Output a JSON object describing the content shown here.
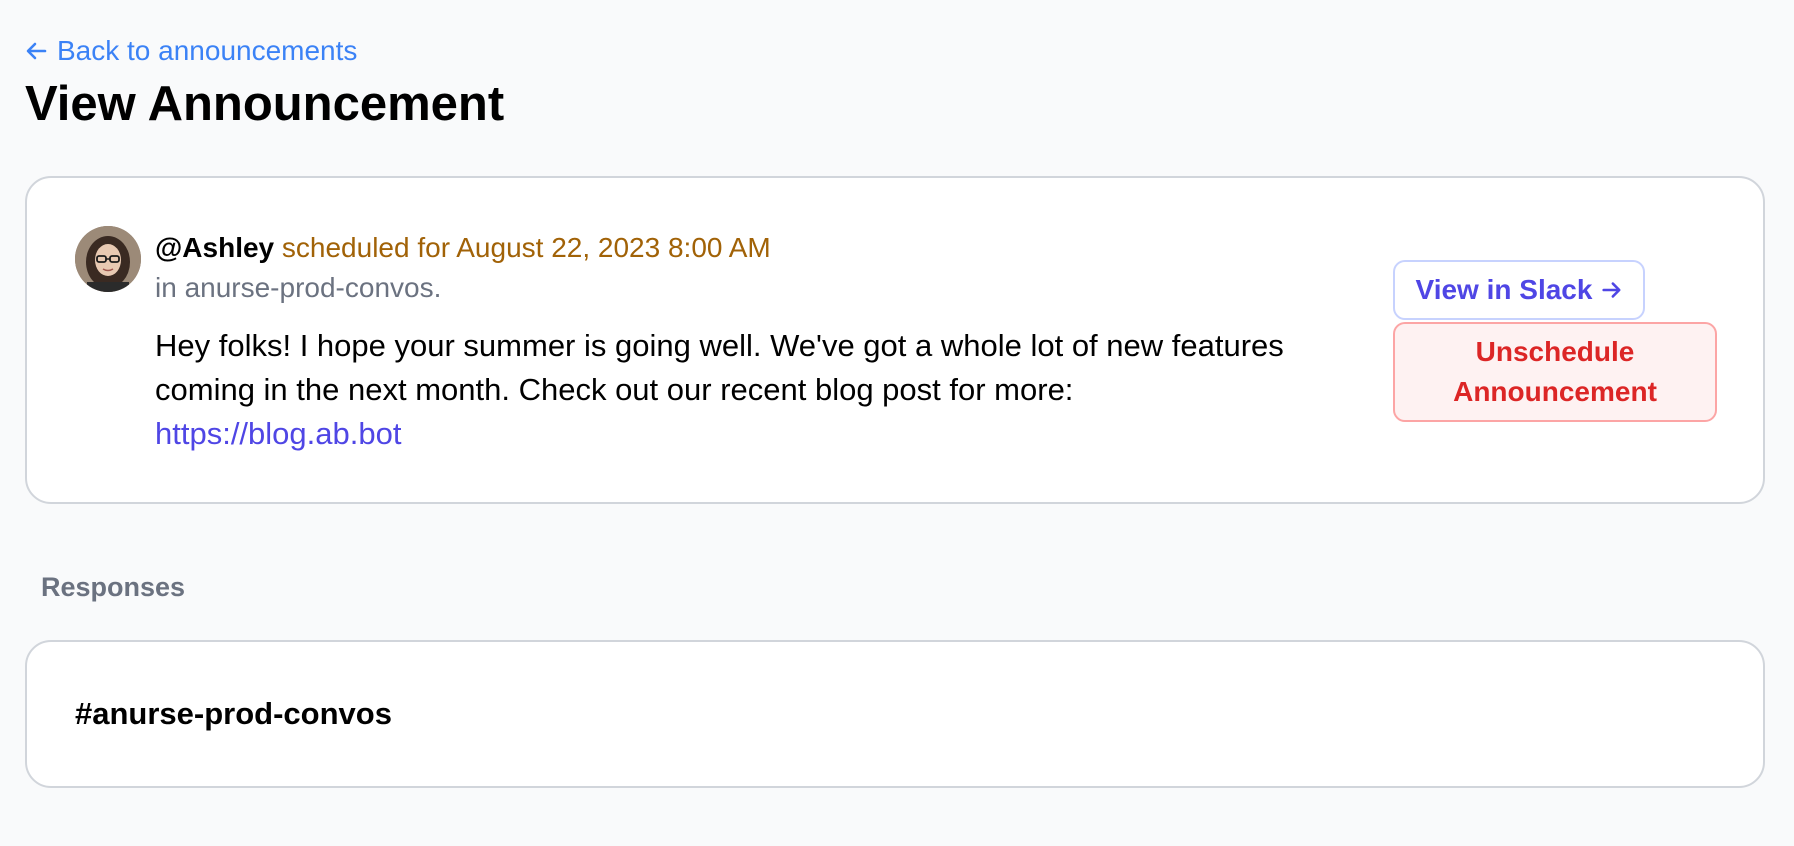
{
  "navigation": {
    "back_label": "Back to announcements"
  },
  "page": {
    "title": "View Announcement"
  },
  "announcement": {
    "author": "@Ashley",
    "schedule_text": "scheduled for August 22, 2023 8:00 AM",
    "channel_text": "in anurse-prod-convos.",
    "message": "Hey folks! I hope your summer is going well. We've got a whole lot of new features coming in the next month. Check out our recent blog post for more:",
    "link": "https://blog.ab.bot",
    "avatar_icon": "user-avatar"
  },
  "actions": {
    "view_in_slack": "View in Slack",
    "unschedule": "Unschedule Announcement"
  },
  "responses": {
    "label": "Responses",
    "channels": [
      {
        "name": "#anurse-prod-convos"
      }
    ]
  },
  "colors": {
    "link_blue": "#3b82f6",
    "accent_indigo": "#4f46e5",
    "schedule_amber": "#a16207",
    "danger_red": "#dc2626",
    "danger_bg": "#fef2f2",
    "muted_gray": "#6b7280",
    "page_bg": "#f9fafb"
  }
}
